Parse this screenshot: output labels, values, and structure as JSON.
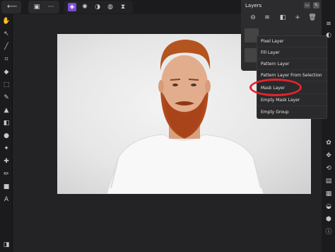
{
  "layers_panel": {
    "title": "Layers",
    "add_menu": [
      "Pixel Layer",
      "Fill Layer",
      "Pattern Layer",
      "Pattern Layer From Selection",
      "Mask Layer",
      "Empty Mask Layer",
      "Empty Group"
    ]
  },
  "colors": {
    "highlight": "#e3242b",
    "toolbar_bg": "#1b1b1d",
    "panel_bg": "#2c2c2e",
    "accent": "#7a4cd6"
  },
  "icons": {
    "back": "arrow-left-icon",
    "document": "document-icon",
    "more": "more-icon",
    "personas": [
      "photo-persona-icon",
      "liquify-persona-icon",
      "develop-persona-icon",
      "tone-mapping-persona-icon",
      "export-persona-icon"
    ]
  }
}
